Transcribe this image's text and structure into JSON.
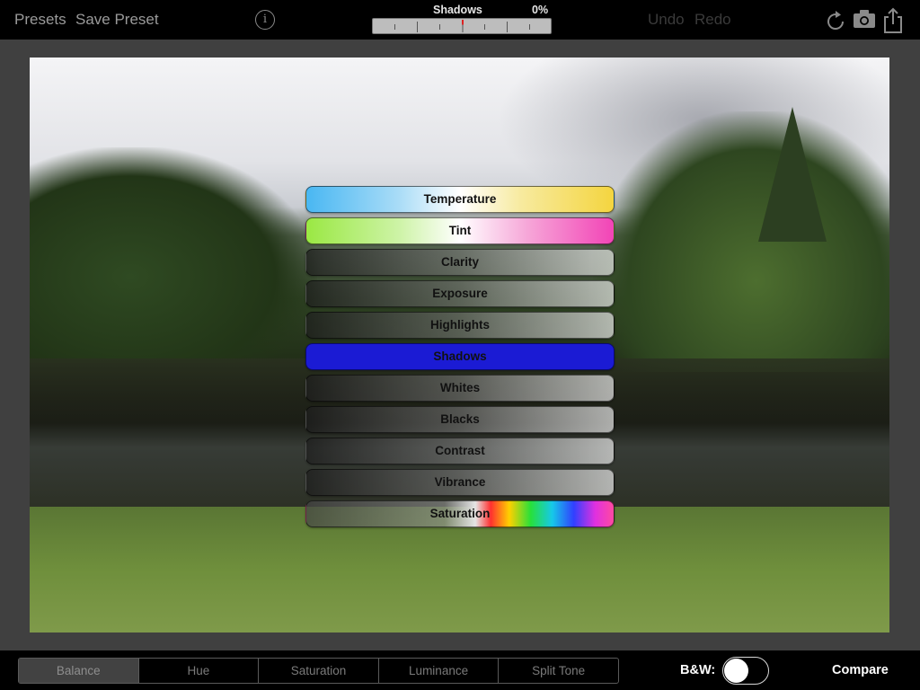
{
  "toolbar": {
    "presets_label": "Presets",
    "save_preset_label": "Save Preset",
    "info_icon": "info-icon",
    "adjustment_name": "Shadows",
    "adjustment_value": "0%",
    "undo_label": "Undo",
    "redo_label": "Redo",
    "right_icons": [
      "rotate-icon",
      "camera-icon",
      "share-icon"
    ]
  },
  "adjustments": [
    {
      "label": "Temperature"
    },
    {
      "label": "Tint"
    },
    {
      "label": "Clarity"
    },
    {
      "label": "Exposure"
    },
    {
      "label": "Highlights"
    },
    {
      "label": "Shadows",
      "selected": true
    },
    {
      "label": "Whites"
    },
    {
      "label": "Blacks"
    },
    {
      "label": "Contrast"
    },
    {
      "label": "Vibrance"
    },
    {
      "label": "Saturation"
    }
  ],
  "bottom": {
    "tabs": [
      "Balance",
      "Hue",
      "Saturation",
      "Luminance",
      "Split Tone"
    ],
    "active_tab": "Balance",
    "bw_label": "B&W:",
    "bw_enabled": false,
    "compare_label": "Compare"
  },
  "colors": {
    "shadows_selected": "#1b1bd4",
    "temperature_cool": "#49b7f2",
    "temperature_warm": "#f4d53f",
    "tint_green": "#9ae843",
    "tint_magenta": "#f244b6"
  }
}
